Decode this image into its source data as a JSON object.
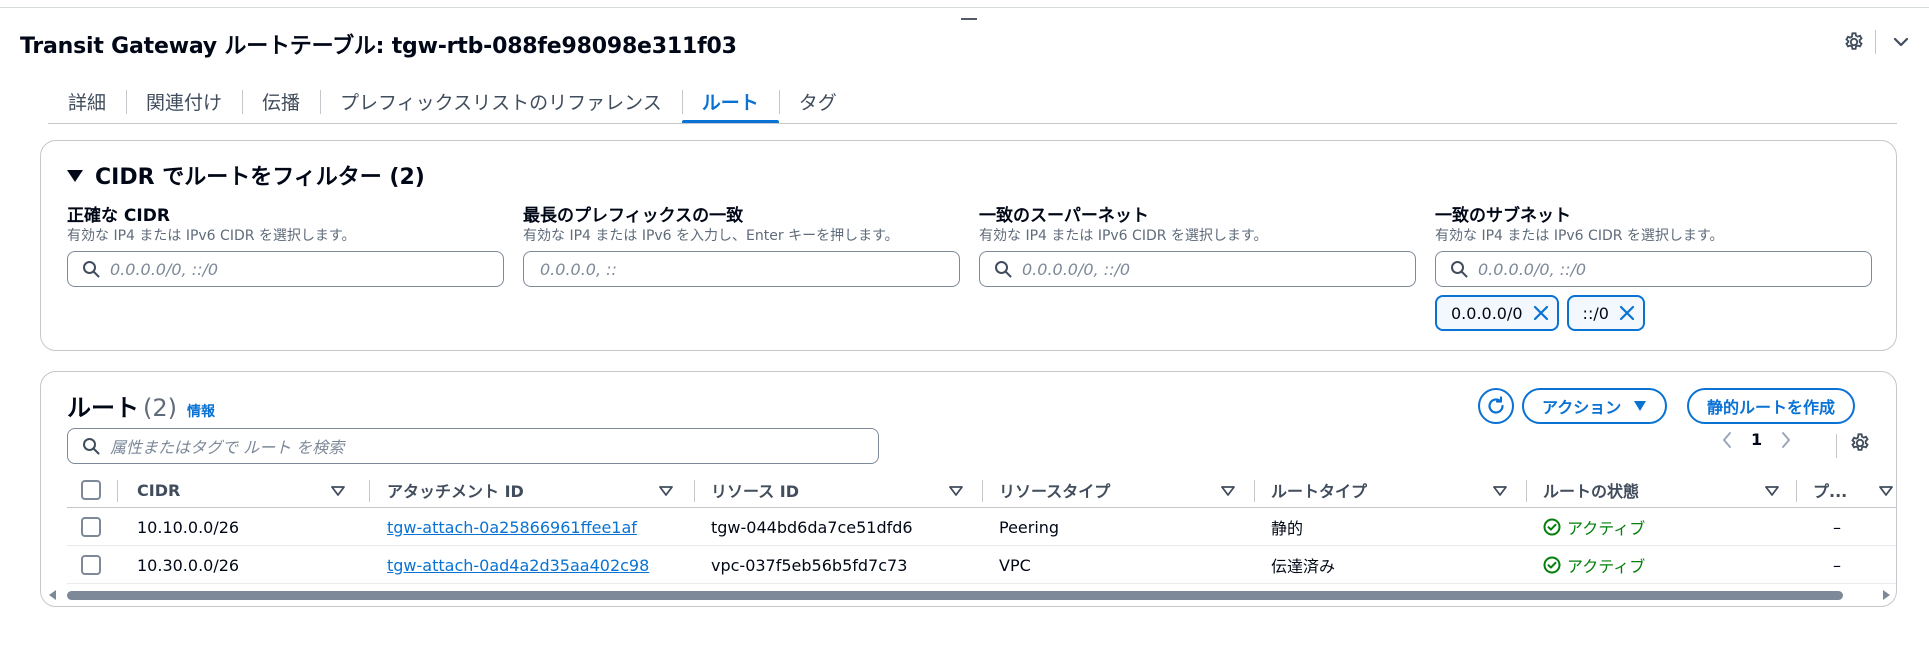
{
  "header": {
    "title": "Transit Gateway ルートテーブル: tgw-rtb-088fe98098e311f03"
  },
  "tabs": [
    {
      "label": "詳細"
    },
    {
      "label": "関連付け"
    },
    {
      "label": "伝播"
    },
    {
      "label": "プレフィックスリストのリファレンス"
    },
    {
      "label": "ルート",
      "active": true
    },
    {
      "label": "タグ"
    }
  ],
  "filter": {
    "title": "CIDR でルートをフィルター (2)",
    "fields": [
      {
        "label": "正確な CIDR",
        "hint": "有効な IP4 または IPv6 CIDR を選択します。",
        "placeholder": "0.0.0.0/0, ::/0"
      },
      {
        "label": "最長のプレフィックスの一致",
        "hint": "有効な IP4 または IPv6 を入力し、Enter キーを押します。",
        "placeholder": "0.0.0.0, ::"
      },
      {
        "label": "一致のスーパーネット",
        "hint": "有効な IP4 または IPv6 CIDR を選択します。",
        "placeholder": "0.0.0.0/0, ::/0"
      },
      {
        "label": "一致のサブネット",
        "hint": "有効な IP4 または IPv6 CIDR を選択します。",
        "placeholder": "0.0.0.0/0, ::/0"
      }
    ],
    "chips": [
      "0.0.0.0/0",
      "::/0"
    ]
  },
  "routes": {
    "title": "ルート",
    "count": "(2)",
    "info": "情報",
    "actions_label": "アクション",
    "create_label": "静的ルートを作成",
    "search_placeholder": "属性またはタグで ルート を検索",
    "page": "1",
    "columns": [
      "CIDR",
      "アタッチメント ID",
      "リソース ID",
      "リソースタイプ",
      "ルートタイプ",
      "ルートの状態",
      "プ..."
    ],
    "rows": [
      {
        "cidr": "10.10.0.0/26",
        "attachment": "tgw-attach-0a25866961ffee1af",
        "resource": "tgw-044bd6da7ce51dfd6",
        "resource_type": "Peering",
        "route_type": "静的",
        "state": "アクティブ",
        "extra": "–"
      },
      {
        "cidr": "10.30.0.0/26",
        "attachment": "tgw-attach-0ad4a2d35aa402c98",
        "resource": "vpc-037f5eb56b5fd7c73",
        "resource_type": "VPC",
        "route_type": "伝達済み",
        "state": "アクティブ",
        "extra": "–"
      }
    ]
  },
  "colors": {
    "accent": "#0972d3",
    "success": "#037f0c",
    "border": "#c6c6cd",
    "text": "#000716"
  }
}
